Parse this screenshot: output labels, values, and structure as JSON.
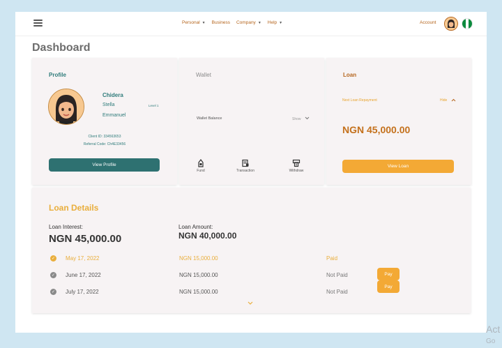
{
  "nav": {
    "menu": [
      {
        "label": "Personal",
        "dropdown": true
      },
      {
        "label": "Business",
        "dropdown": false
      },
      {
        "label": "Company",
        "dropdown": true
      },
      {
        "label": "Help",
        "dropdown": true
      }
    ],
    "account_label": "Account"
  },
  "page": {
    "title": "Dashboard"
  },
  "profile": {
    "title": "Profile",
    "first_name": "Chidera",
    "middle_name": "Stella",
    "last_name": "Emmanuel",
    "level": "Level 1",
    "client_id": "Client ID: 334563653",
    "referral_code": "Referral Code: Ch4E33456",
    "button": "View Profile"
  },
  "wallet": {
    "title": "Wallet",
    "balance_label": "Wallet Balance",
    "balance_toggle": "Show",
    "actions": [
      {
        "label": "Fund",
        "icon": "fund-icon"
      },
      {
        "label": "Transaction",
        "icon": "transaction-icon"
      },
      {
        "label": "Withdraw",
        "icon": "withdraw-icon"
      }
    ]
  },
  "loan": {
    "title": "Loan",
    "next_label": "Next Loan Repayment",
    "next_toggle": "Hide",
    "amount": "NGN 45,000.00",
    "button": "View Loan"
  },
  "loan_details": {
    "title": "Loan Details",
    "interest_label": "Loan Interest:",
    "interest_value": "NGN 45,000.00",
    "amount_label": "Loan Amount:",
    "amount_value": "NGN 40,000.00",
    "rows": [
      {
        "date": "May 17, 2022",
        "amount": "NGN 15,000.00",
        "status": "Paid",
        "pay": ""
      },
      {
        "date": "June 17, 2022",
        "amount": "NGN 15,000.00",
        "status": "Not Paid",
        "pay": "Pay"
      },
      {
        "date": "July 17, 2022",
        "amount": "NGN 15,000.00",
        "status": "Not Paid",
        "pay": "Pay"
      }
    ]
  },
  "watermark": {
    "line1": "Act",
    "line2": "Go"
  },
  "colors": {
    "teal": "#2e7171",
    "orange": "#f3a935",
    "loan_text": "#c4711c",
    "accent_gold": "#e9ae3c"
  }
}
